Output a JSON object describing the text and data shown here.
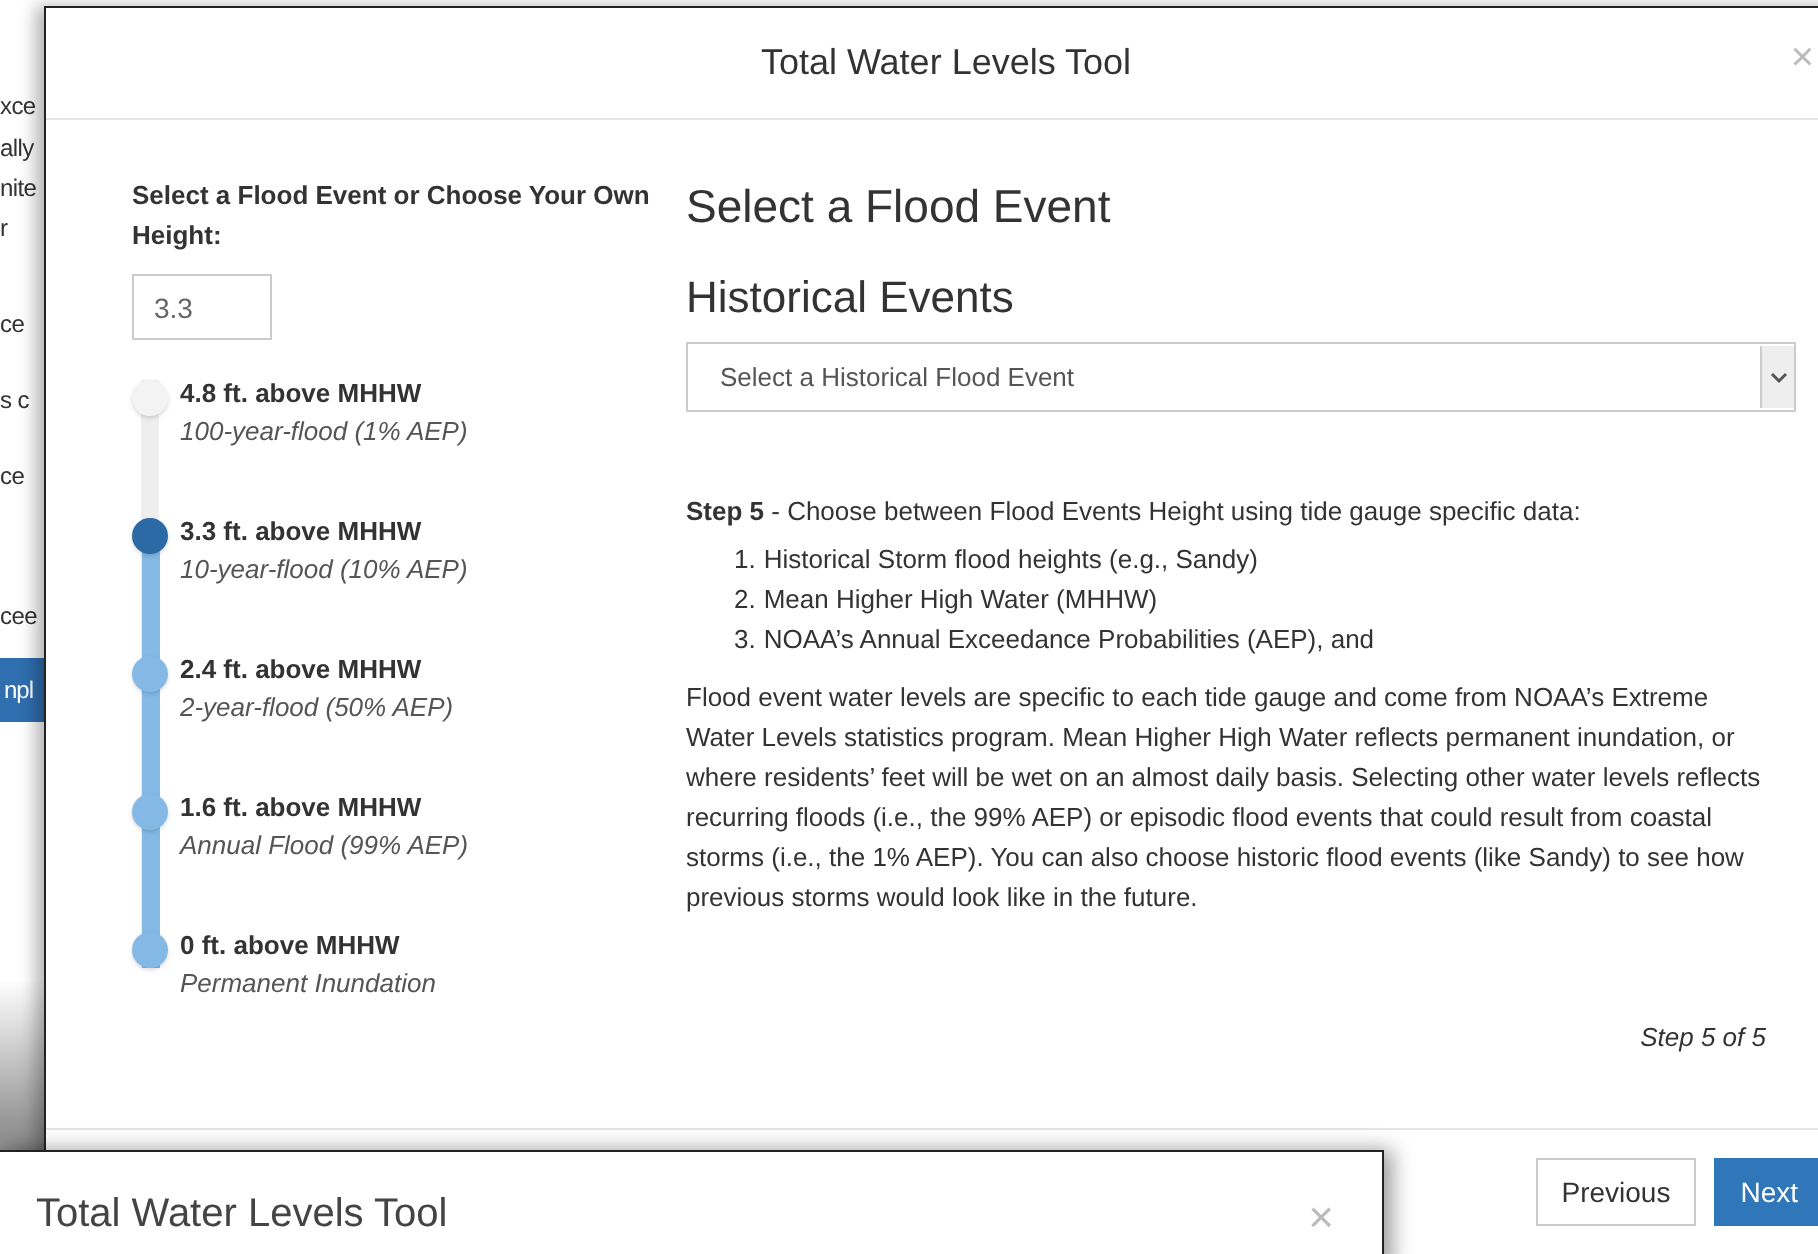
{
  "background_page": {
    "fragments": [
      "xce",
      "ally",
      "nite",
      "r",
      "ce",
      "s c",
      "ce",
      "cee"
    ],
    "button": "npl"
  },
  "window": {
    "title": "Total Water Levels Tool",
    "close": "×"
  },
  "height_panel": {
    "label": "Select a Flood Event or Choose Your Own Height:",
    "value": "3.3",
    "level": 0.75,
    "stops": [
      {
        "height": "4.8 ft. above MHHW",
        "name": "100-year-flood (1% AEP)",
        "selected": false
      },
      {
        "height": "3.3 ft. above MHHW",
        "name": "10-year-flood (10% AEP)",
        "selected": true
      },
      {
        "height": "2.4 ft. above MHHW",
        "name": "2-year-flood (50% AEP)",
        "selected": false
      },
      {
        "height": "1.6 ft. above MHHW",
        "name": "Annual Flood (99% AEP)",
        "selected": false
      },
      {
        "height": "0 ft. above MHHW",
        "name": "Permanent Inundation",
        "selected": false
      }
    ]
  },
  "content": {
    "heading": "Select a Flood Event",
    "subheading": "Historical Events",
    "select_placeholder": "Select a Historical Flood Event",
    "intro": "**Step 5** - Choose between Flood Events Height using tide gauge specific data:",
    "list": [
      {
        "marker": "1.",
        "text": "Historical Storm flood heights (e.g., Sandy)"
      },
      {
        "marker": "2.",
        "text": "Mean Higher High Water (MHHW)"
      },
      {
        "marker": "3.",
        "text": "NOAA’s Annual Exceedance Probabilities (AEP), and"
      }
    ],
    "paragraph": "Flood event water levels are specific to each tide gauge and come from NOAA’s Extreme Water Levels statistics program. Mean Higher High Water reflects permanent inundation, or where residents’ feet will be wet on an almost daily basis. Selecting other water levels reflects recurring floods (i.e., the 99% AEP) or episodic flood events that could result from coastal storms (i.e., the 1% AEP). You can also choose historic flood events (like Sandy) to see how previous storms would look like in the future.",
    "step": "Step 5 of 5"
  },
  "footer": {
    "buttons": [
      {
        "label": "Previous",
        "kind": "secondary"
      },
      {
        "label": "Next",
        "kind": "primary"
      }
    ]
  },
  "second_window": {
    "title": "Total Water Levels Tool",
    "close": "×"
  }
}
